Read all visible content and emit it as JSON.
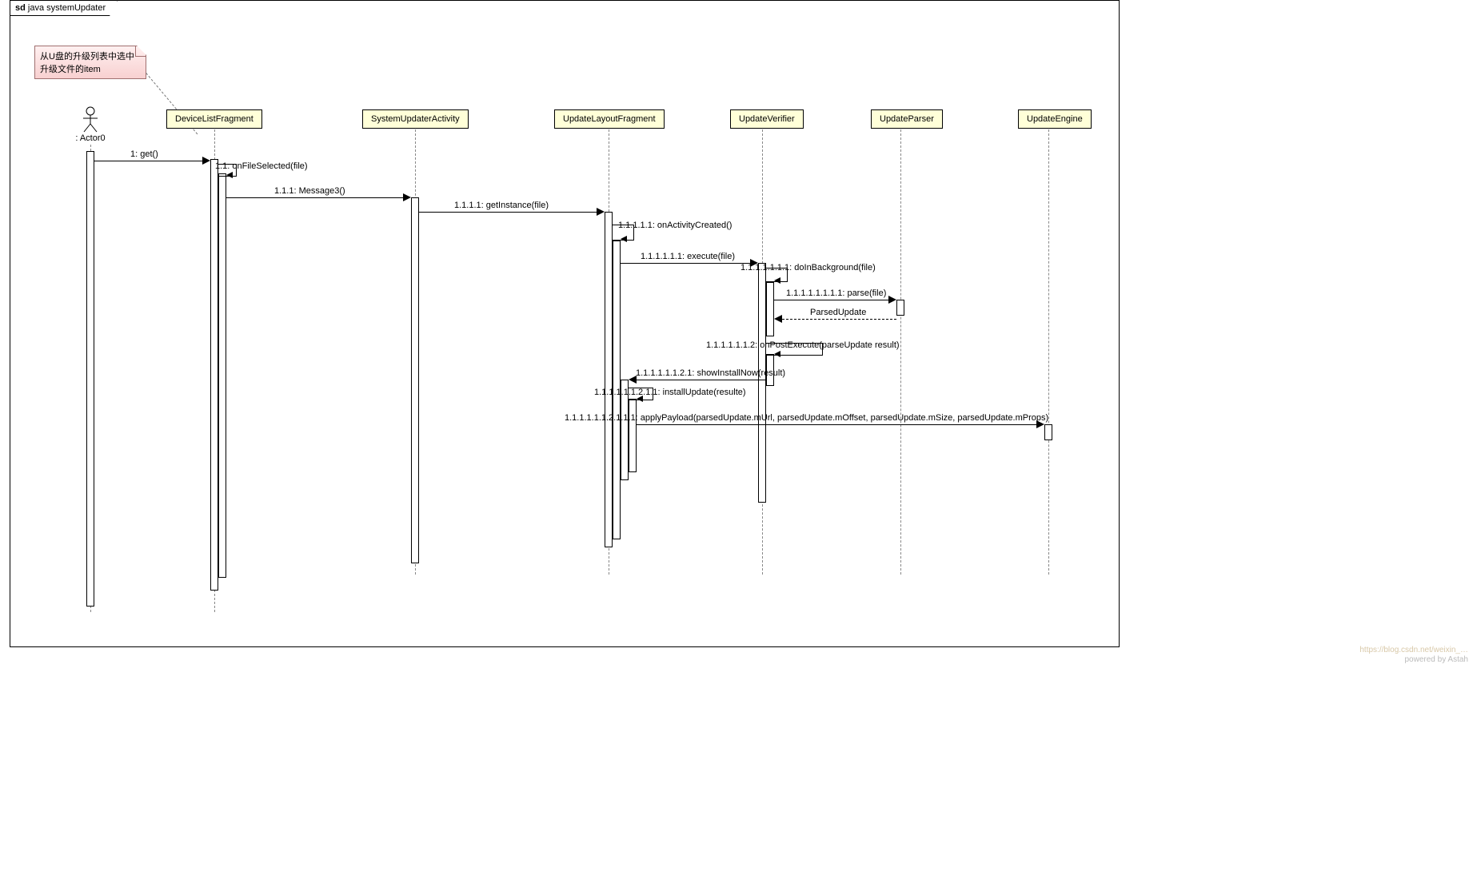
{
  "frame": {
    "prefix": "sd",
    "title": "java systemUpdater"
  },
  "note": {
    "line1": "从U盘的升级列表中选中",
    "line2": "升级文件的item"
  },
  "actor": {
    "label": ": Actor0"
  },
  "participants": {
    "deviceList": "DeviceListFragment",
    "sysActivity": "SystemUpdaterActivity",
    "layoutFrag": "UpdateLayoutFragment",
    "verifier": "UpdateVerifier",
    "parser": "UpdateParser",
    "engine": "UpdateEngine"
  },
  "messages": {
    "m1": "1: get()",
    "m1_1": "1.1: onFileSelected(file)",
    "m1_1_1": "1.1.1: Message3()",
    "m1_1_1_1": "1.1.1.1: getInstance(file)",
    "m1_1_1_1_1": "1.1.1.1.1: onActivityCreated()",
    "m_exec": "1.1.1.1.1.1: execute(file)",
    "m_doinbg": "1.1.1.1.1.1.1: doInBackground(file)",
    "m_parse": "1.1.1.1.1.1.1.1: parse(file)",
    "m_return": "ParsedUpdate",
    "m_post": "1.1.1.1.1.1.2: onPostExecute(parseUpdate result)",
    "m_show": "1.1.1.1.1.1.2.1: showInstallNow(result)",
    "m_install": "1.1.1.1.1.1.2.1.1: installUpdate(resulte)",
    "m_apply": "1.1.1.1.1.1.2.1.1.1: applyPayload(parsedUpdate.mUrl, parsedUpdate.mOffset, parsedUpdate.mSize, parsedUpdate.mProps)"
  },
  "footer": {
    "csdn": "https://blog.csdn.net/weixin_…",
    "astah": "powered by Astah"
  }
}
